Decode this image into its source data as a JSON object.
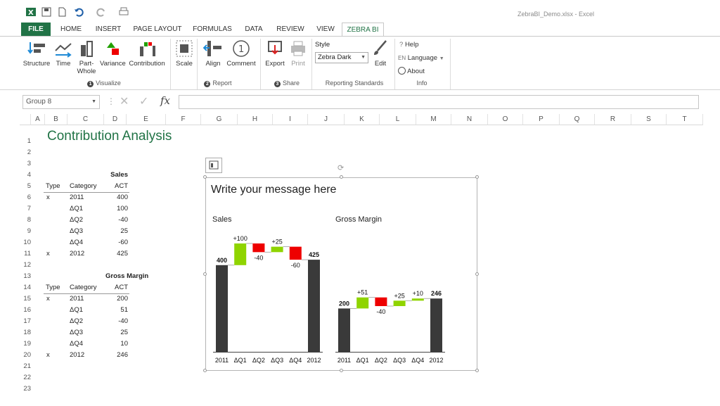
{
  "window": {
    "title": "ZebraBI_Demo.xlsx - Excel"
  },
  "tabs": [
    {
      "label": "FILE"
    },
    {
      "label": "HOME"
    },
    {
      "label": "INSERT"
    },
    {
      "label": "PAGE LAYOUT"
    },
    {
      "label": "FORMULAS"
    },
    {
      "label": "DATA"
    },
    {
      "label": "REVIEW"
    },
    {
      "label": "VIEW"
    },
    {
      "label": "ZEBRA BI"
    }
  ],
  "ribbon": {
    "visualize": {
      "structure": "Structure",
      "time": "Time",
      "part": "Part-",
      "whole": "Whole",
      "variance": "Variance",
      "contribution": "Contribution",
      "group": "Visualize",
      "num": "1"
    },
    "report": {
      "scale": "Scale",
      "align": "Align",
      "comment": "Comment",
      "group": "Report",
      "num": "2"
    },
    "share": {
      "export": "Export",
      "print": "Print",
      "group": "Share",
      "num": "3"
    },
    "standards": {
      "style_label": "Style",
      "style_value": "Zebra Dark",
      "edit": "Edit",
      "group": "Reporting Standards"
    },
    "info": {
      "help": "Help",
      "lang_code": "EN",
      "language": "Language",
      "about": "About",
      "group": "Info"
    }
  },
  "formula_bar": {
    "name_box": "Group 8",
    "fx": "fx"
  },
  "columns": [
    "A",
    "B",
    "C",
    "D",
    "E",
    "F",
    "G",
    "H",
    "I",
    "J",
    "K",
    "L",
    "M",
    "N",
    "O",
    "P",
    "Q",
    "R",
    "S",
    "T"
  ],
  "rows": [
    "1",
    "2",
    "3",
    "4",
    "5",
    "6",
    "7",
    "8",
    "9",
    "10",
    "11",
    "12",
    "13",
    "14",
    "15",
    "16",
    "17",
    "18",
    "19",
    "20",
    "21",
    "22",
    "23"
  ],
  "sheet": {
    "title": "Contribution Analysis",
    "table1": {
      "measure": "Sales",
      "headers": [
        "Type",
        "Category",
        "ACT"
      ],
      "rows": [
        {
          "type": "x",
          "category": "2011",
          "act": "400"
        },
        {
          "type": "",
          "category": "ΔQ1",
          "act": "100"
        },
        {
          "type": "",
          "category": "ΔQ2",
          "act": "-40"
        },
        {
          "type": "",
          "category": "ΔQ3",
          "act": "25"
        },
        {
          "type": "",
          "category": "ΔQ4",
          "act": "-60"
        },
        {
          "type": "x",
          "category": "2012",
          "act": "425"
        }
      ]
    },
    "table2": {
      "measure": "Gross Margin",
      "headers": [
        "Type",
        "Category",
        "ACT"
      ],
      "rows": [
        {
          "type": "x",
          "category": "2011",
          "act": "200"
        },
        {
          "type": "",
          "category": "ΔQ1",
          "act": "51"
        },
        {
          "type": "",
          "category": "ΔQ2",
          "act": "-40"
        },
        {
          "type": "",
          "category": "ΔQ3",
          "act": "25"
        },
        {
          "type": "",
          "category": "ΔQ4",
          "act": "10"
        },
        {
          "type": "x",
          "category": "2012",
          "act": "246"
        }
      ]
    }
  },
  "chart_panel": {
    "message": "Write your message here"
  },
  "chart_data": [
    {
      "type": "bar",
      "title": "Sales",
      "categories": [
        "2011",
        "ΔQ1",
        "ΔQ2",
        "ΔQ3",
        "ΔQ4",
        "2012"
      ],
      "values": [
        400,
        100,
        -40,
        25,
        -60,
        425
      ],
      "labels": [
        "400",
        "+100",
        "-40",
        "+25",
        "-60",
        "425"
      ],
      "kinds": [
        "total",
        "delta",
        "delta",
        "delta",
        "delta",
        "total"
      ]
    },
    {
      "type": "bar",
      "title": "Gross Margin",
      "categories": [
        "2011",
        "ΔQ1",
        "ΔQ2",
        "ΔQ3",
        "ΔQ4",
        "2012"
      ],
      "values": [
        200,
        51,
        -40,
        25,
        10,
        246
      ],
      "labels": [
        "200",
        "+51",
        "-40",
        "+25",
        "+10",
        "246"
      ],
      "kinds": [
        "total",
        "delta",
        "delta",
        "delta",
        "delta",
        "total"
      ]
    }
  ],
  "colors": {
    "brand": "#217346",
    "total": "#3a3a3a",
    "positive": "#8fd400",
    "negative": "#ee0000"
  }
}
